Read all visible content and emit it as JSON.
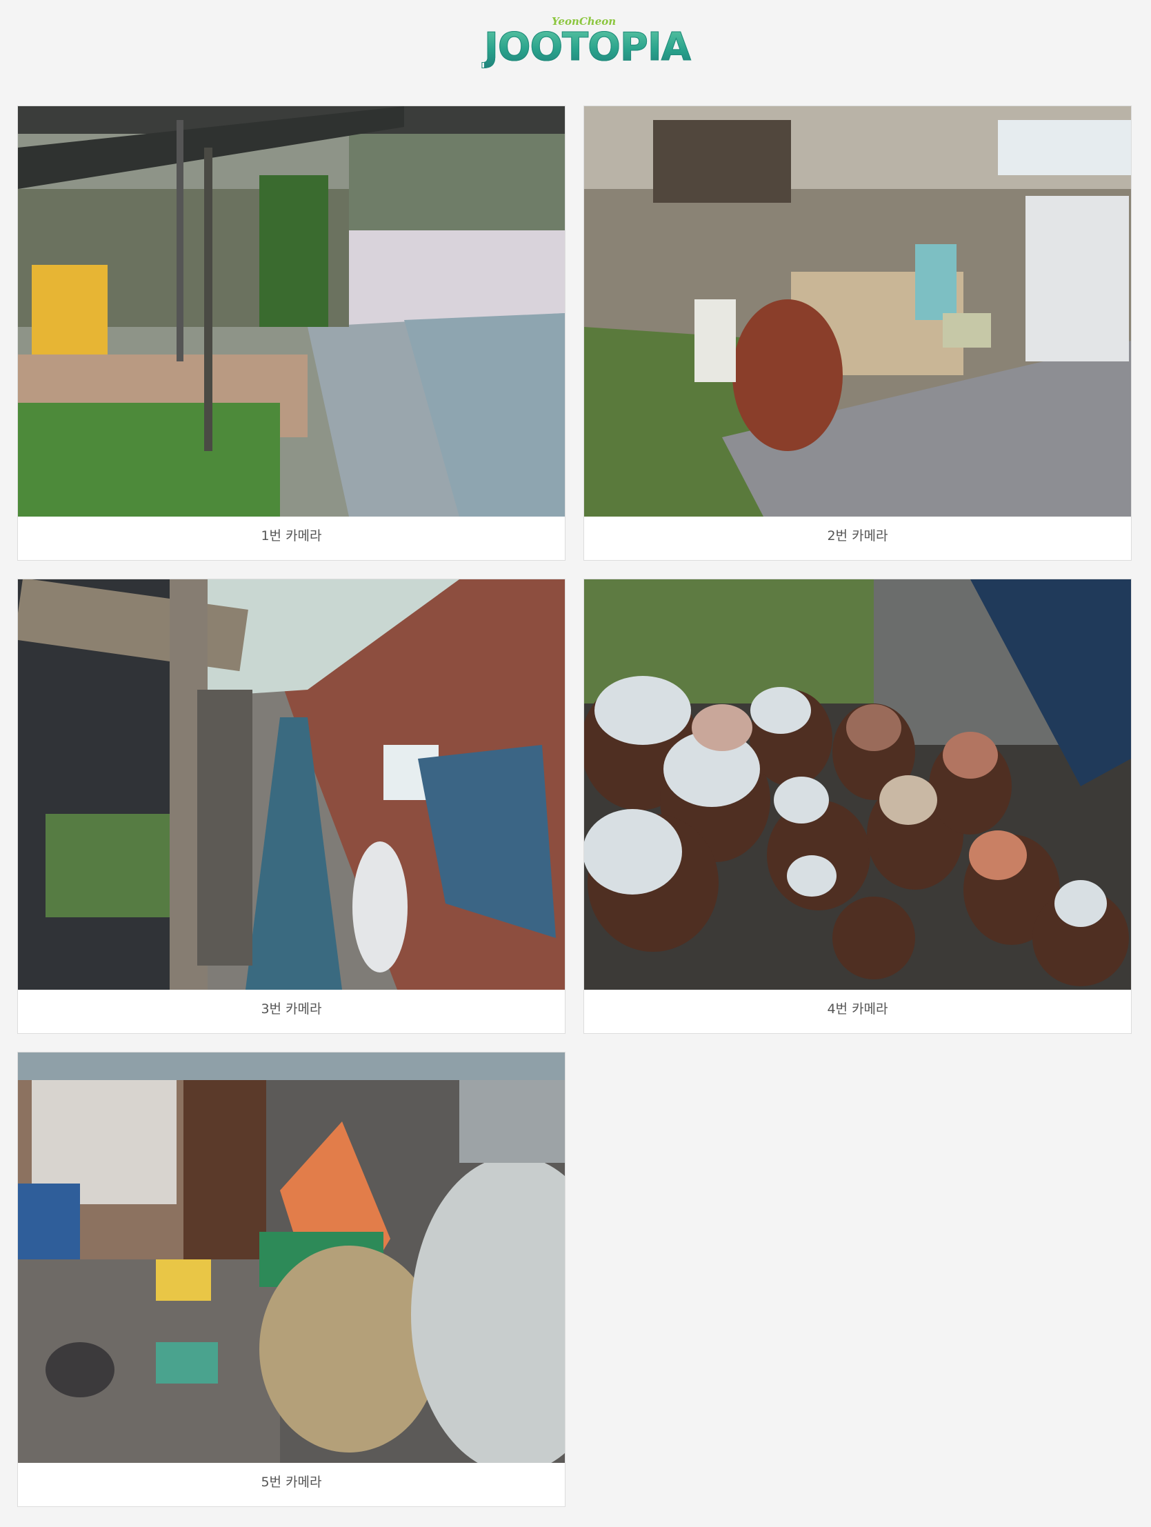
{
  "header": {
    "logo_subtitle": "YeonCheon",
    "logo_title": "JOOTOPIA"
  },
  "cameras": [
    {
      "label": "1번 카메라",
      "icon": "camera-feed-image"
    },
    {
      "label": "2번 카메라",
      "icon": "camera-feed-image"
    },
    {
      "label": "3번 카메라",
      "icon": "camera-feed-image"
    },
    {
      "label": "4번 카메라",
      "icon": "camera-feed-image"
    },
    {
      "label": "5번 카메라",
      "icon": "camera-feed-image"
    }
  ],
  "colors": {
    "page_background": "#f4f4f4",
    "card_background": "#ffffff",
    "label_text": "#555555",
    "logo_green": "#2aa38c",
    "logo_sub_green": "#8cc63f"
  }
}
